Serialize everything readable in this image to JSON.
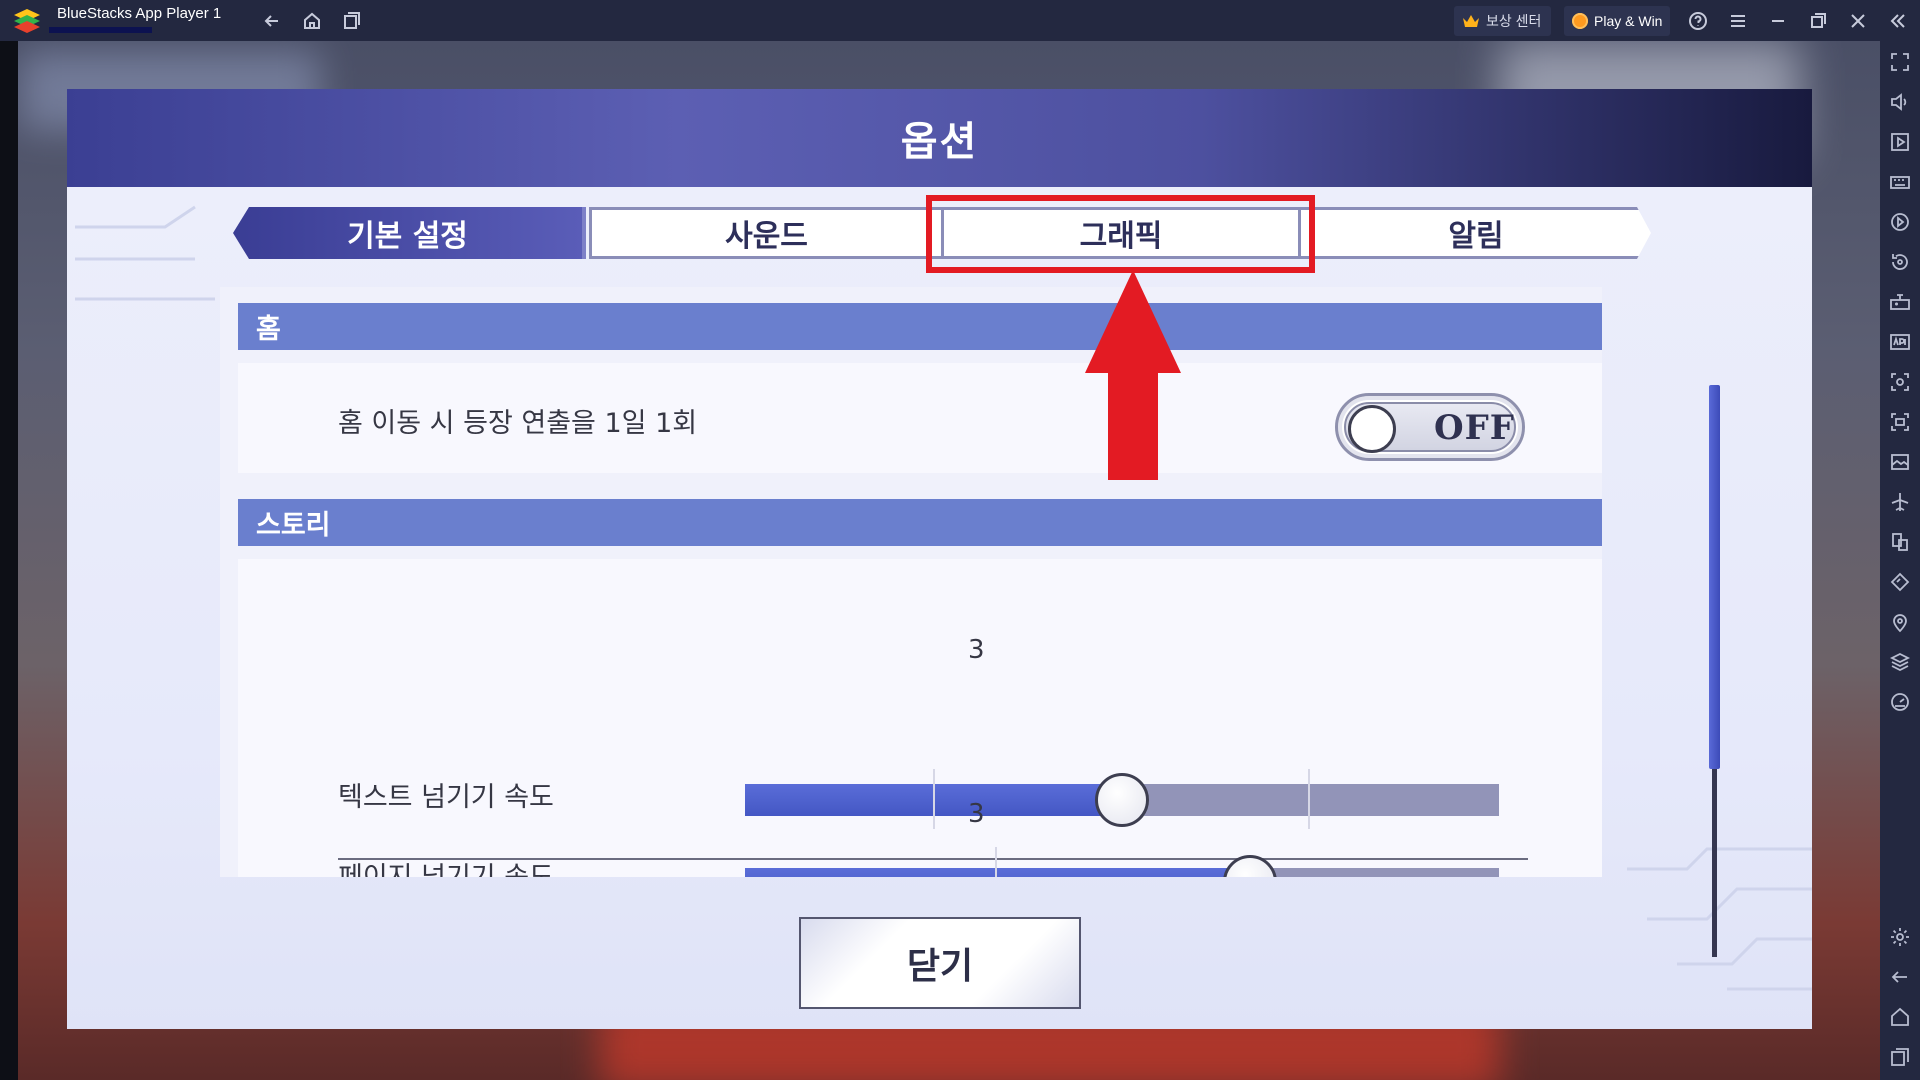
{
  "window": {
    "app_title": "BlueStacks App Player 1",
    "reward_center_label": "보상 센터",
    "play_win_label": "Play & Win"
  },
  "dialog": {
    "title": "옵션",
    "tabs": [
      {
        "label": "기본 설정",
        "selected": true
      },
      {
        "label": "사운드",
        "selected": false
      },
      {
        "label": "그래픽",
        "selected": false
      },
      {
        "label": "알림",
        "selected": false
      }
    ],
    "sections": {
      "home": {
        "header": "홈",
        "setting_label": "홈 이동 시 등장 연출을 1일 1회",
        "toggle_text": "OFF",
        "toggle_on": false
      },
      "story": {
        "header": "스토리",
        "text_speed_label": "텍스트 넘기기 속도",
        "text_speed_value": "3",
        "text_speed_fraction": 0.5,
        "page_speed_label": "페이지 넘기기 속도",
        "page_speed_value": "3",
        "page_speed_fraction": 0.67
      }
    },
    "close_label": "닫기"
  },
  "annotation": {
    "highlight_color": "#e31b23",
    "highlighted_tab": "그래픽"
  },
  "colors": {
    "section_header": "#6a7fce",
    "slider_fill": "#4a5ccb",
    "slider_track": "#9294b8",
    "titlebar": "#232840"
  },
  "icons": {
    "titlebar": [
      "back-icon",
      "home-icon",
      "multi-instance-icon",
      "crown-icon",
      "coin-icon",
      "help-icon",
      "menu-icon",
      "minimize-icon",
      "restore-icon",
      "close-icon",
      "collapse-sidebar-icon"
    ],
    "sidebar": [
      "fullscreen-icon",
      "volume-icon",
      "media-icon",
      "keyboard-icon",
      "macro-icon",
      "rotate-icon",
      "gamepad-icon",
      "apk-icon",
      "screenshot-icon",
      "record-icon",
      "media-folder-icon",
      "airplane-icon",
      "multi-instance-icon",
      "eco-mode-icon",
      "location-icon",
      "layers-icon",
      "performance-icon",
      "settings-icon",
      "back-icon",
      "home-icon",
      "recent-apps-icon"
    ]
  }
}
